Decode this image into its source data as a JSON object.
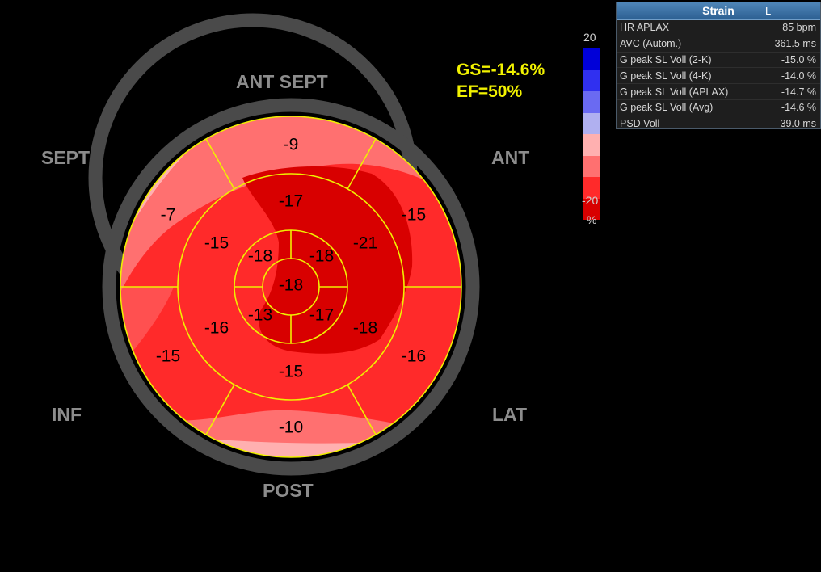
{
  "wall_labels": {
    "ant_sept": "ANT  SEPT",
    "ant": "ANT",
    "sept": "SEPT",
    "inf": "INF",
    "lat": "LAT",
    "post": "POST"
  },
  "summary": {
    "gs": "GS=-14.6%",
    "ef": "EF=50%"
  },
  "segments": {
    "basal": [
      "-9",
      "-15",
      "-16",
      "-10",
      "-15",
      "-7"
    ],
    "mid": [
      "-17",
      "-21",
      "-18",
      "-15",
      "-16",
      "-15"
    ],
    "apical": [
      "-18",
      "-17",
      "-13",
      "-18"
    ],
    "apex": "-18"
  },
  "color_scale": {
    "max": "20",
    "min": "-20",
    "unit": "%",
    "colors": [
      "#0000d8",
      "#3030f0",
      "#6a6af2",
      "#b0b0f0",
      "#ffb0b0",
      "#ff7070",
      "#ff2a2a",
      "#d80000"
    ]
  },
  "strain_panel": {
    "title": "Strain",
    "lock_symbol": "L",
    "rows": [
      {
        "label": "HR APLAX",
        "value": "85 bpm"
      },
      {
        "label": "AVC (Autom.)",
        "value": "361.5 ms"
      },
      {
        "label": "G peak SL Voll (2-K)",
        "value": "-15.0 %"
      },
      {
        "label": "G peak SL Voll (4-K)",
        "value": "-14.0 %"
      },
      {
        "label": "G peak SL Voll (APLAX)",
        "value": "-14.7 %"
      },
      {
        "label": "G peak SL Voll (Avg)",
        "value": "-14.6 %"
      },
      {
        "label": "PSD Voll",
        "value": "39.0 ms"
      }
    ]
  },
  "colors": {
    "grid_line": "#f0f000",
    "ring": "#4a4a4a",
    "base_red": "#ff2a2a",
    "dark_red": "#d80000",
    "light_red": "#ff7070",
    "pale_red": "#ffb0b0"
  }
}
